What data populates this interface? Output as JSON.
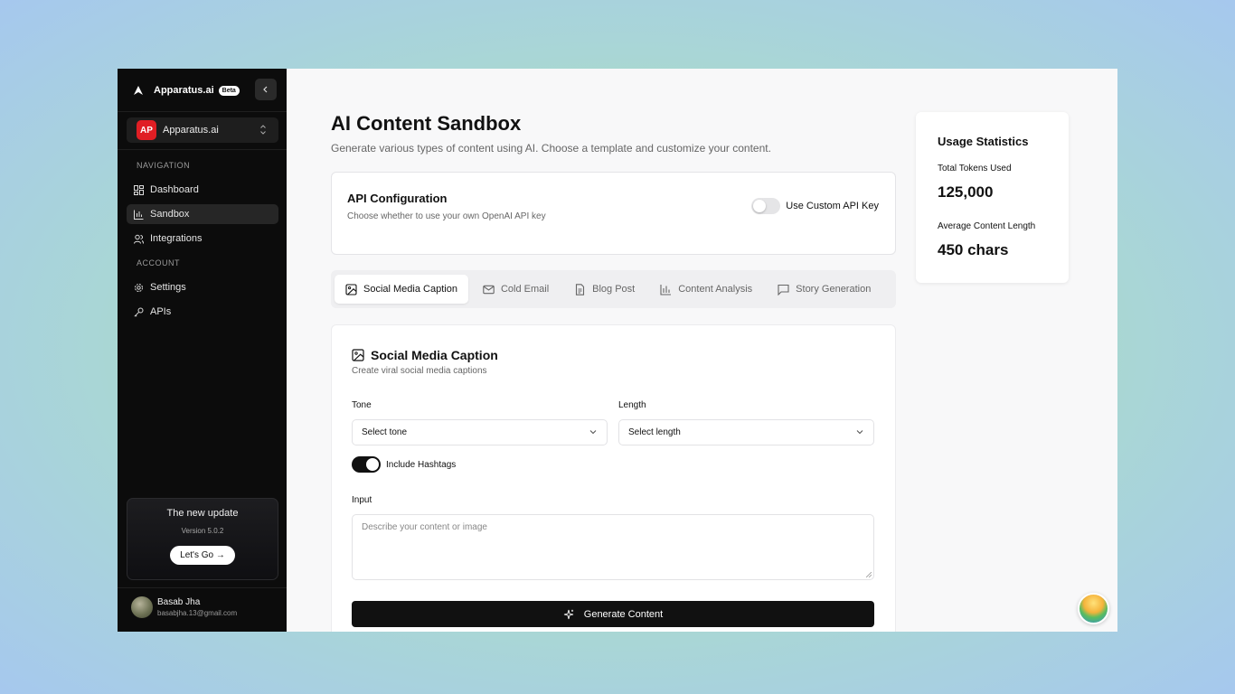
{
  "sidebar": {
    "brand": "Apparatus.ai",
    "beta": "Beta",
    "org": {
      "initials": "AP",
      "name": "Apparatus.ai",
      "color": "#e01e24"
    },
    "nav_label": "NAVIGATION",
    "nav": [
      {
        "label": "Dashboard",
        "icon": "dashboard-icon",
        "active": false
      },
      {
        "label": "Sandbox",
        "icon": "chart-icon",
        "active": true
      },
      {
        "label": "Integrations",
        "icon": "users-icon",
        "active": false
      }
    ],
    "account_label": "ACCOUNT",
    "account": [
      {
        "label": "Settings",
        "icon": "gear-icon"
      },
      {
        "label": "APIs",
        "icon": "key-icon"
      }
    ],
    "update": {
      "title": "The new update",
      "version": "Version 5.0.2",
      "button": "Let's Go →"
    },
    "user": {
      "name": "Basab Jha",
      "email": "basabjha.13@gmail.com"
    }
  },
  "main": {
    "title": "AI Content Sandbox",
    "subtitle": "Generate various types of content using AI. Choose a template and customize your content.",
    "api": {
      "title": "API Configuration",
      "subtitle": "Choose whether to use your own OpenAI API key",
      "toggle_label": "Use Custom API Key",
      "toggle_on": false
    },
    "tabs": [
      {
        "label": "Social Media Caption",
        "icon": "image-icon",
        "active": true
      },
      {
        "label": "Cold Email",
        "icon": "mail-icon",
        "active": false
      },
      {
        "label": "Blog Post",
        "icon": "document-icon",
        "active": false
      },
      {
        "label": "Content Analysis",
        "icon": "bar-chart-icon",
        "active": false
      },
      {
        "label": "Story Generation",
        "icon": "message-icon",
        "active": false
      }
    ],
    "form": {
      "title": "Social Media Caption",
      "subtitle": "Create viral social media captions",
      "tone_label": "Tone",
      "tone_value": "Select tone",
      "length_label": "Length",
      "length_value": "Select length",
      "hashtags_label": "Include Hashtags",
      "hashtags_on": true,
      "input_label": "Input",
      "input_placeholder": "Describe your content or image",
      "generate": "Generate Content"
    },
    "stats": {
      "title": "Usage Statistics",
      "tokens_label": "Total Tokens Used",
      "tokens_value": "125,000",
      "length_label": "Average Content Length",
      "length_value": "450 chars"
    }
  }
}
